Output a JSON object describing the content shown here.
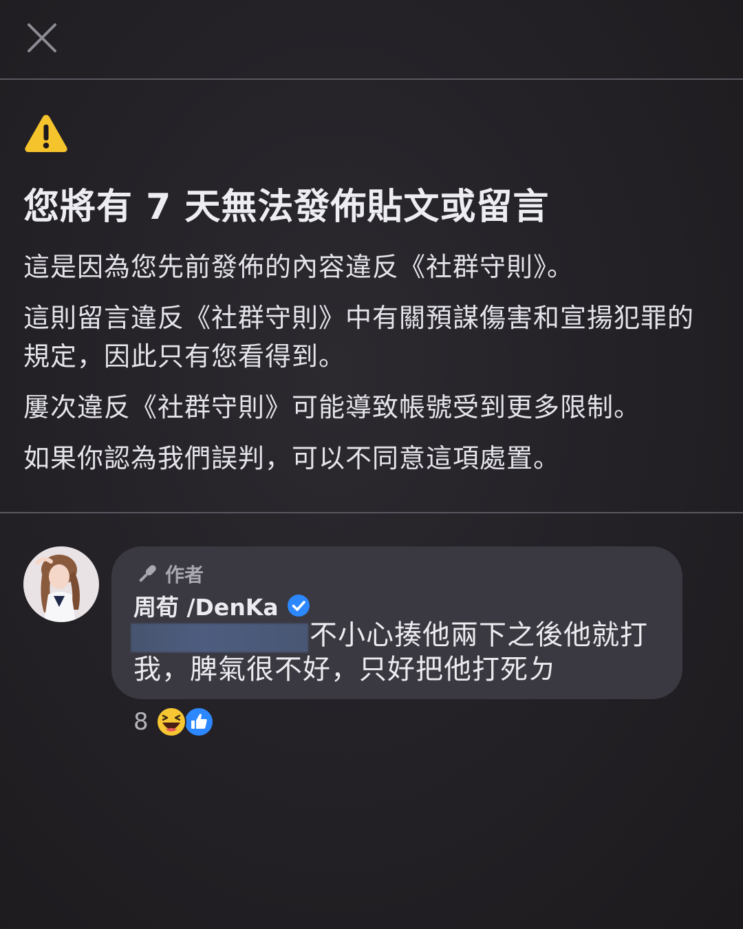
{
  "dialog": {
    "title": "您將有 7 天無法發佈貼文或留言",
    "paragraphs": [
      "這是因為您先前發佈的內容違反《社群守則》。",
      "這則留言違反《社群守則》中有關預謀傷害和宣揚犯罪的規定，因此只有您看得到。",
      "屢次違反《社群守則》可能導致帳號受到更多限制。",
      "如果你認為我們誤判，可以不同意這項處置。"
    ],
    "icons": {
      "close": "close-icon",
      "warning": "warning-icon"
    },
    "colors": {
      "warning": "#f5c32c",
      "background": "#242227"
    }
  },
  "comment": {
    "author_badge": "作者",
    "name": "周荀 /DenKa",
    "text": "不小心揍他兩下之後他就打我，脾氣很不好，只好把他打死ㄉ",
    "reaction_count": "8",
    "reactions": [
      "haha-icon",
      "like-icon"
    ],
    "colors": {
      "bubble": "#3a3941",
      "verified": "#2d88ff",
      "like": "#2d88ff",
      "haha": "#f7c733"
    }
  }
}
